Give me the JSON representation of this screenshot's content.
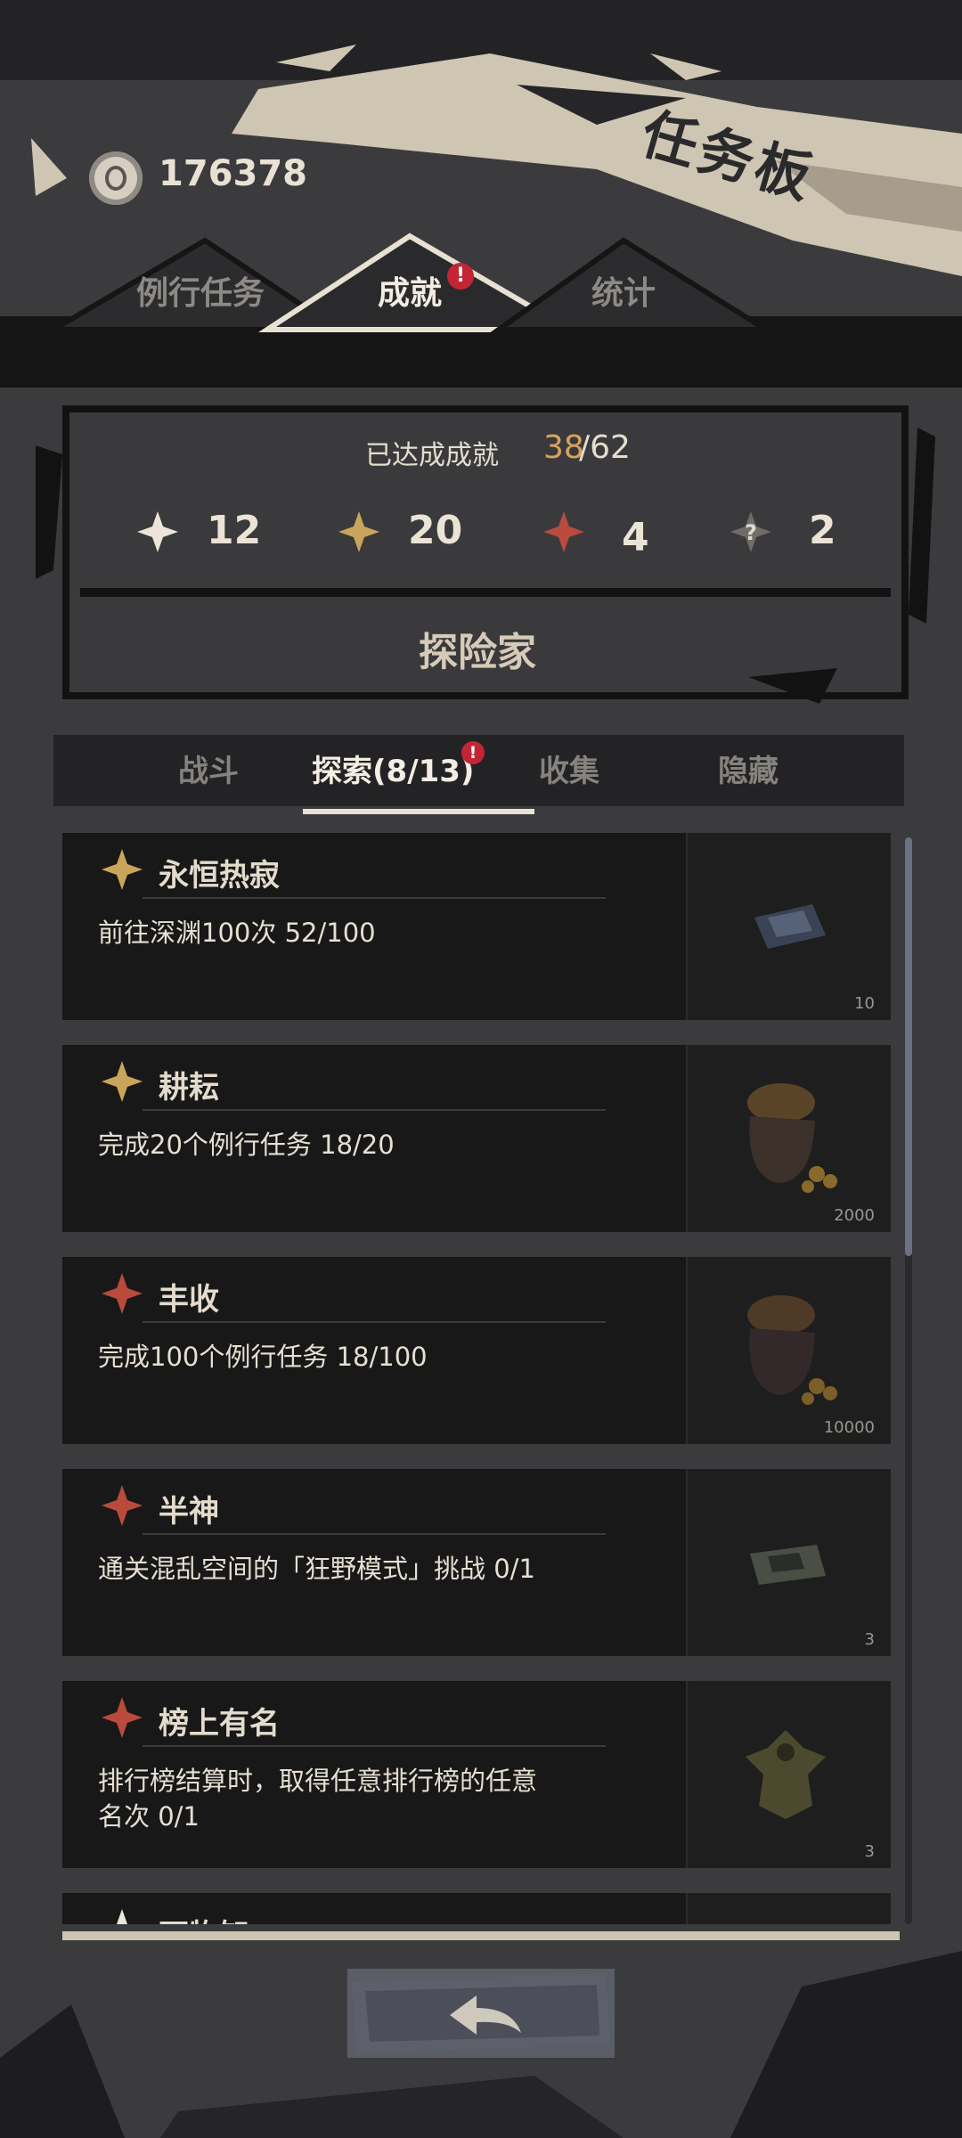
{
  "header": {
    "title": "任务板",
    "coins": "176378"
  },
  "tabs": [
    {
      "label": "例行任务",
      "active": false,
      "badge": false
    },
    {
      "label": "成就",
      "active": true,
      "badge": true
    },
    {
      "label": "统计",
      "active": false,
      "badge": false
    }
  ],
  "badge_symbol": "!",
  "summary": {
    "label": "已达成成就",
    "completed": "38",
    "total_text": "/62",
    "counts": [
      {
        "icon": "white-star-icon",
        "color": "#ece6da",
        "value": "12"
      },
      {
        "icon": "gold-star-icon",
        "color": "#c9a55c",
        "value": "20"
      },
      {
        "icon": "red-star-icon",
        "color": "#b94a3c",
        "value": "4"
      },
      {
        "icon": "hidden-star-icon",
        "color": "#6f6d69",
        "value": "2"
      }
    ],
    "rank": "探险家"
  },
  "subtabs": [
    {
      "label": "战斗",
      "active": false
    },
    {
      "label": "探索(8/13)",
      "active": true,
      "badge": true
    },
    {
      "label": "收集",
      "active": false
    },
    {
      "label": "隐藏",
      "active": false
    }
  ],
  "achievements": [
    {
      "title": "永恒热寂",
      "star": "gold",
      "desc": "前往深渊100次 52/100",
      "reward_icon": "map-item-icon",
      "reward_qty": "10"
    },
    {
      "title": "耕耘",
      "star": "gold",
      "desc": "完成20个例行任务 18/20",
      "reward_icon": "coin-pouch-icon",
      "reward_qty": "2000"
    },
    {
      "title": "丰收",
      "star": "red",
      "desc": "完成100个例行任务 18/100",
      "reward_icon": "coin-pouch-icon",
      "reward_qty": "10000"
    },
    {
      "title": "半神",
      "star": "red",
      "desc": "通关混乱空间的「狂野模式」挑战 0/1",
      "reward_icon": "map-item-icon",
      "reward_qty": "3"
    },
    {
      "title": "榜上有名",
      "star": "red",
      "desc": "排行榜结算时，取得任意排行榜的任意名次 0/1",
      "reward_icon": "creature-item-icon",
      "reward_qty": "3"
    },
    {
      "title": "万物知",
      "star": "white",
      "desc": "",
      "reward_icon": "",
      "reward_qty": ""
    }
  ],
  "colors": {
    "gold_star": "#c9a55c",
    "red_star": "#b94a3c",
    "white_star": "#ece6da",
    "badge": "#c42535",
    "accent_orange": "#d8a35e"
  },
  "back_button_icon": "back-arrow-icon"
}
